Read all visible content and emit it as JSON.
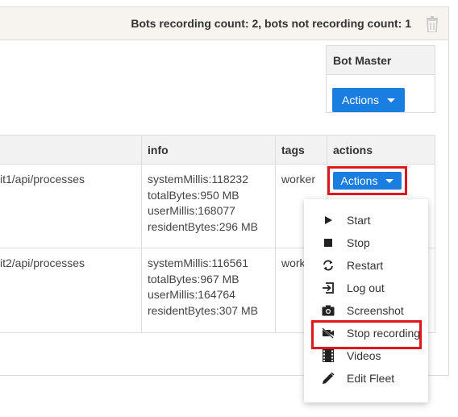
{
  "header": {
    "status_text": "Bots recording count: 2, bots not recording count: 1"
  },
  "bot_master": {
    "title": "Bot Master",
    "actions_label": "Actions"
  },
  "table": {
    "columns": [
      "info",
      "tags",
      "actions"
    ],
    "rows": [
      {
        "url": "it1/api/processes",
        "info": [
          "systemMillis:118232",
          "totalBytes:950 MB",
          "userMillis:168077",
          "residentBytes:296 MB"
        ],
        "tags": "worker",
        "actions_label": "Actions"
      },
      {
        "url": "it2/api/processes",
        "info": [
          "systemMillis:116561",
          "totalBytes:967 MB",
          "userMillis:164764",
          "residentBytes:307 MB"
        ],
        "tags": "worke"
      }
    ]
  },
  "menu": {
    "items": [
      {
        "label": "Start",
        "icon": "play-icon"
      },
      {
        "label": "Stop",
        "icon": "stop-icon"
      },
      {
        "label": "Restart",
        "icon": "restart-icon"
      },
      {
        "label": "Log out",
        "icon": "logout-icon"
      },
      {
        "label": "Screenshot",
        "icon": "camera-icon"
      },
      {
        "label": "Stop recording",
        "icon": "videocam-off-icon"
      },
      {
        "label": "Videos",
        "icon": "film-icon"
      },
      {
        "label": "Edit Fleet",
        "icon": "pencil-icon"
      }
    ]
  },
  "colors": {
    "accent": "#1a7ee0",
    "highlight": "#e0161e",
    "header_bg": "#f7f3ef"
  }
}
